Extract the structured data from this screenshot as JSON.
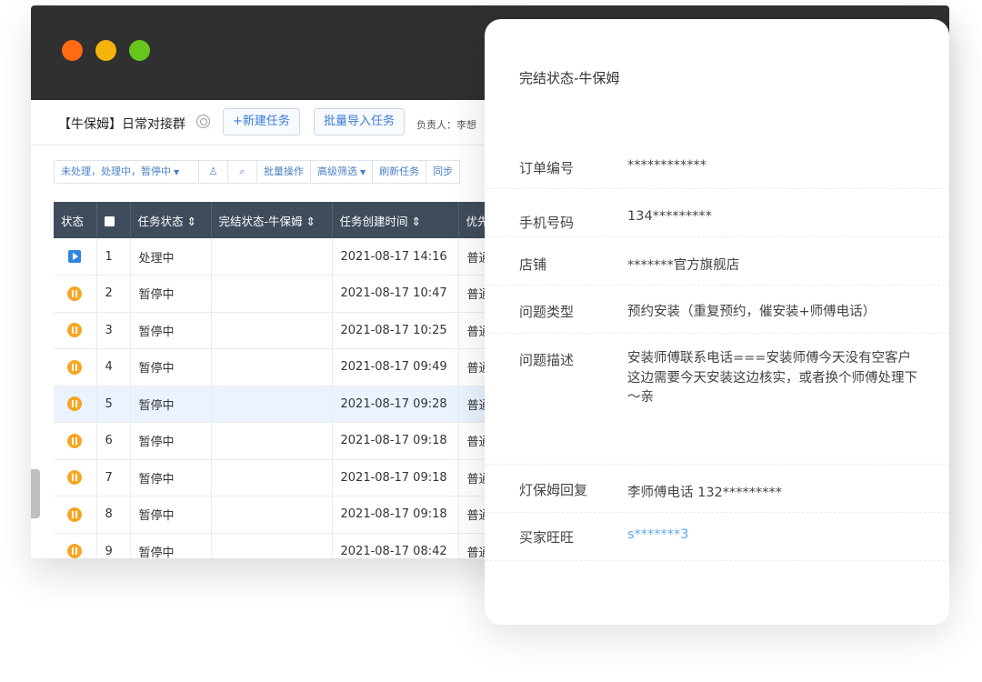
{
  "window": {
    "group_title": "【牛保姆】日常对接群",
    "new_task_label": "+新建任务",
    "import_label": "批量导入任务",
    "owner_label": "负责人：",
    "owner_value": "李想"
  },
  "filters": {
    "status_filter": "未处理，处理中，暂停中",
    "batch_ops": "批量操作",
    "advanced_filter": "高级筛选",
    "refresh": "刷新任务",
    "sync": "同步"
  },
  "table": {
    "columns": [
      "状态",
      "",
      "任务状态",
      "完结状态-牛保姆",
      "任务创建时间",
      "优先"
    ],
    "rows": [
      {
        "status": "play",
        "index": "1",
        "task_status": "处理中",
        "done_status": "",
        "created": "2021-08-17 14:16",
        "priority": "普通"
      },
      {
        "status": "pause",
        "index": "2",
        "task_status": "暂停中",
        "done_status": "",
        "created": "2021-08-17 10:47",
        "priority": "普通"
      },
      {
        "status": "pause",
        "index": "3",
        "task_status": "暂停中",
        "done_status": "",
        "created": "2021-08-17 10:25",
        "priority": "普通"
      },
      {
        "status": "pause",
        "index": "4",
        "task_status": "暂停中",
        "done_status": "",
        "created": "2021-08-17 09:49",
        "priority": "普通"
      },
      {
        "status": "pause",
        "index": "5",
        "task_status": "暂停中",
        "done_status": "",
        "created": "2021-08-17 09:28",
        "priority": "普通"
      },
      {
        "status": "pause",
        "index": "6",
        "task_status": "暂停中",
        "done_status": "",
        "created": "2021-08-17 09:18",
        "priority": "普通"
      },
      {
        "status": "pause",
        "index": "7",
        "task_status": "暂停中",
        "done_status": "",
        "created": "2021-08-17 09:18",
        "priority": "普通"
      },
      {
        "status": "pause",
        "index": "8",
        "task_status": "暂停中",
        "done_status": "",
        "created": "2021-08-17 09:18",
        "priority": "普通"
      },
      {
        "status": "pause",
        "index": "9",
        "task_status": "暂停中",
        "done_status": "",
        "created": "2021-08-17 08:42",
        "priority": "普通"
      }
    ]
  },
  "detail": {
    "title": "完结状态-牛保姆",
    "order_label": "订单编号",
    "order_value": "************",
    "phone_label": "手机号码",
    "phone_value": "134*********",
    "shop_label": "店铺",
    "shop_value": "*******官方旗舰店",
    "issue_type_label": "问题类型",
    "issue_type_value": "预约安装（重复预约，催安装+师傅电话）",
    "issue_desc_label": "问题描述",
    "issue_desc_value": "安装师傅联系电话===安装师傅今天没有空客户这边需要今天安装这边核实，或者换个师傅处理下～亲",
    "reply_label": "灯保姆回复",
    "reply_value": "李师傅电话 132*********",
    "buyer_label": "买家旺旺",
    "buyer_value": "s*******3"
  },
  "colors": {
    "titlebar": "#303030",
    "close": "#ff6a13",
    "minimize": "#f5b40a",
    "maximize": "#66c61c",
    "table_header": "#3f4c5c",
    "accent": "#3a7bd5",
    "pause": "#f6a623",
    "link": "#5aabe8"
  }
}
